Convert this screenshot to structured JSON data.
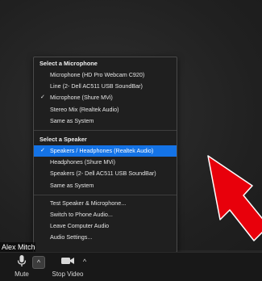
{
  "microphone_section": {
    "title": "Select a Microphone",
    "items": [
      {
        "label": "Microphone (HD Pro Webcam C920)",
        "checked": false
      },
      {
        "label": "Line (2- Dell AC511 USB SoundBar)",
        "checked": false
      },
      {
        "label": "Microphone (Shure MVi)",
        "checked": true
      },
      {
        "label": "Stereo Mix (Realtek Audio)",
        "checked": false
      },
      {
        "label": "Same as System",
        "checked": false
      }
    ]
  },
  "speaker_section": {
    "title": "Select a Speaker",
    "items": [
      {
        "label": "Speakers / Headphones (Realtek Audio)",
        "checked": true,
        "highlighted": true
      },
      {
        "label": "Headphones (Shure MVi)",
        "checked": false
      },
      {
        "label": "Speakers (2- Dell AC511 USB SoundBar)",
        "checked": false
      },
      {
        "label": "Same as System",
        "checked": false
      }
    ]
  },
  "actions": [
    {
      "label": "Test Speaker & Microphone..."
    },
    {
      "label": "Switch to Phone Audio..."
    },
    {
      "label": "Leave Computer Audio"
    },
    {
      "label": "Audio Settings..."
    }
  ],
  "participant": {
    "name": "Alex Mitche"
  },
  "toolbar": {
    "mute_label": "Mute",
    "stop_video_label": "Stop Video",
    "caret_glyph": "^",
    "check_glyph": "✓"
  },
  "colors": {
    "highlight": "#1473e6",
    "arrow": "#e8000b",
    "menu_bg": "#1f1f1f"
  },
  "icons": {
    "mute": "microphone-icon",
    "video": "video-camera-icon",
    "pointer": "red-arrow-icon"
  }
}
